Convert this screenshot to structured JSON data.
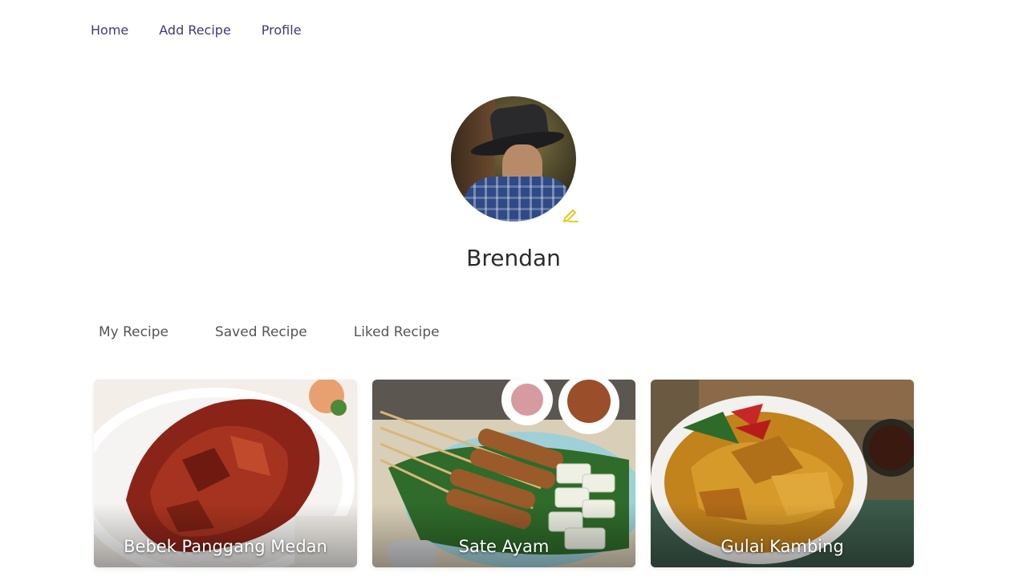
{
  "nav": {
    "home": "Home",
    "add_recipe": "Add Recipe",
    "profile": "Profile"
  },
  "profile": {
    "name": "Brendan",
    "edit_icon": "pencil-icon"
  },
  "tabs": {
    "my_recipe": "My Recipe",
    "saved_recipe": "Saved Recipe",
    "liked_recipe": "Liked Recipe"
  },
  "recipes": [
    {
      "title": "Bebek Panggang Medan"
    },
    {
      "title": "Sate Ayam"
    },
    {
      "title": "Gulai Kambing"
    }
  ],
  "colors": {
    "nav_link": "#3f3a7a",
    "accent_edit": "#e6c200",
    "text": "#2b2b2b"
  }
}
